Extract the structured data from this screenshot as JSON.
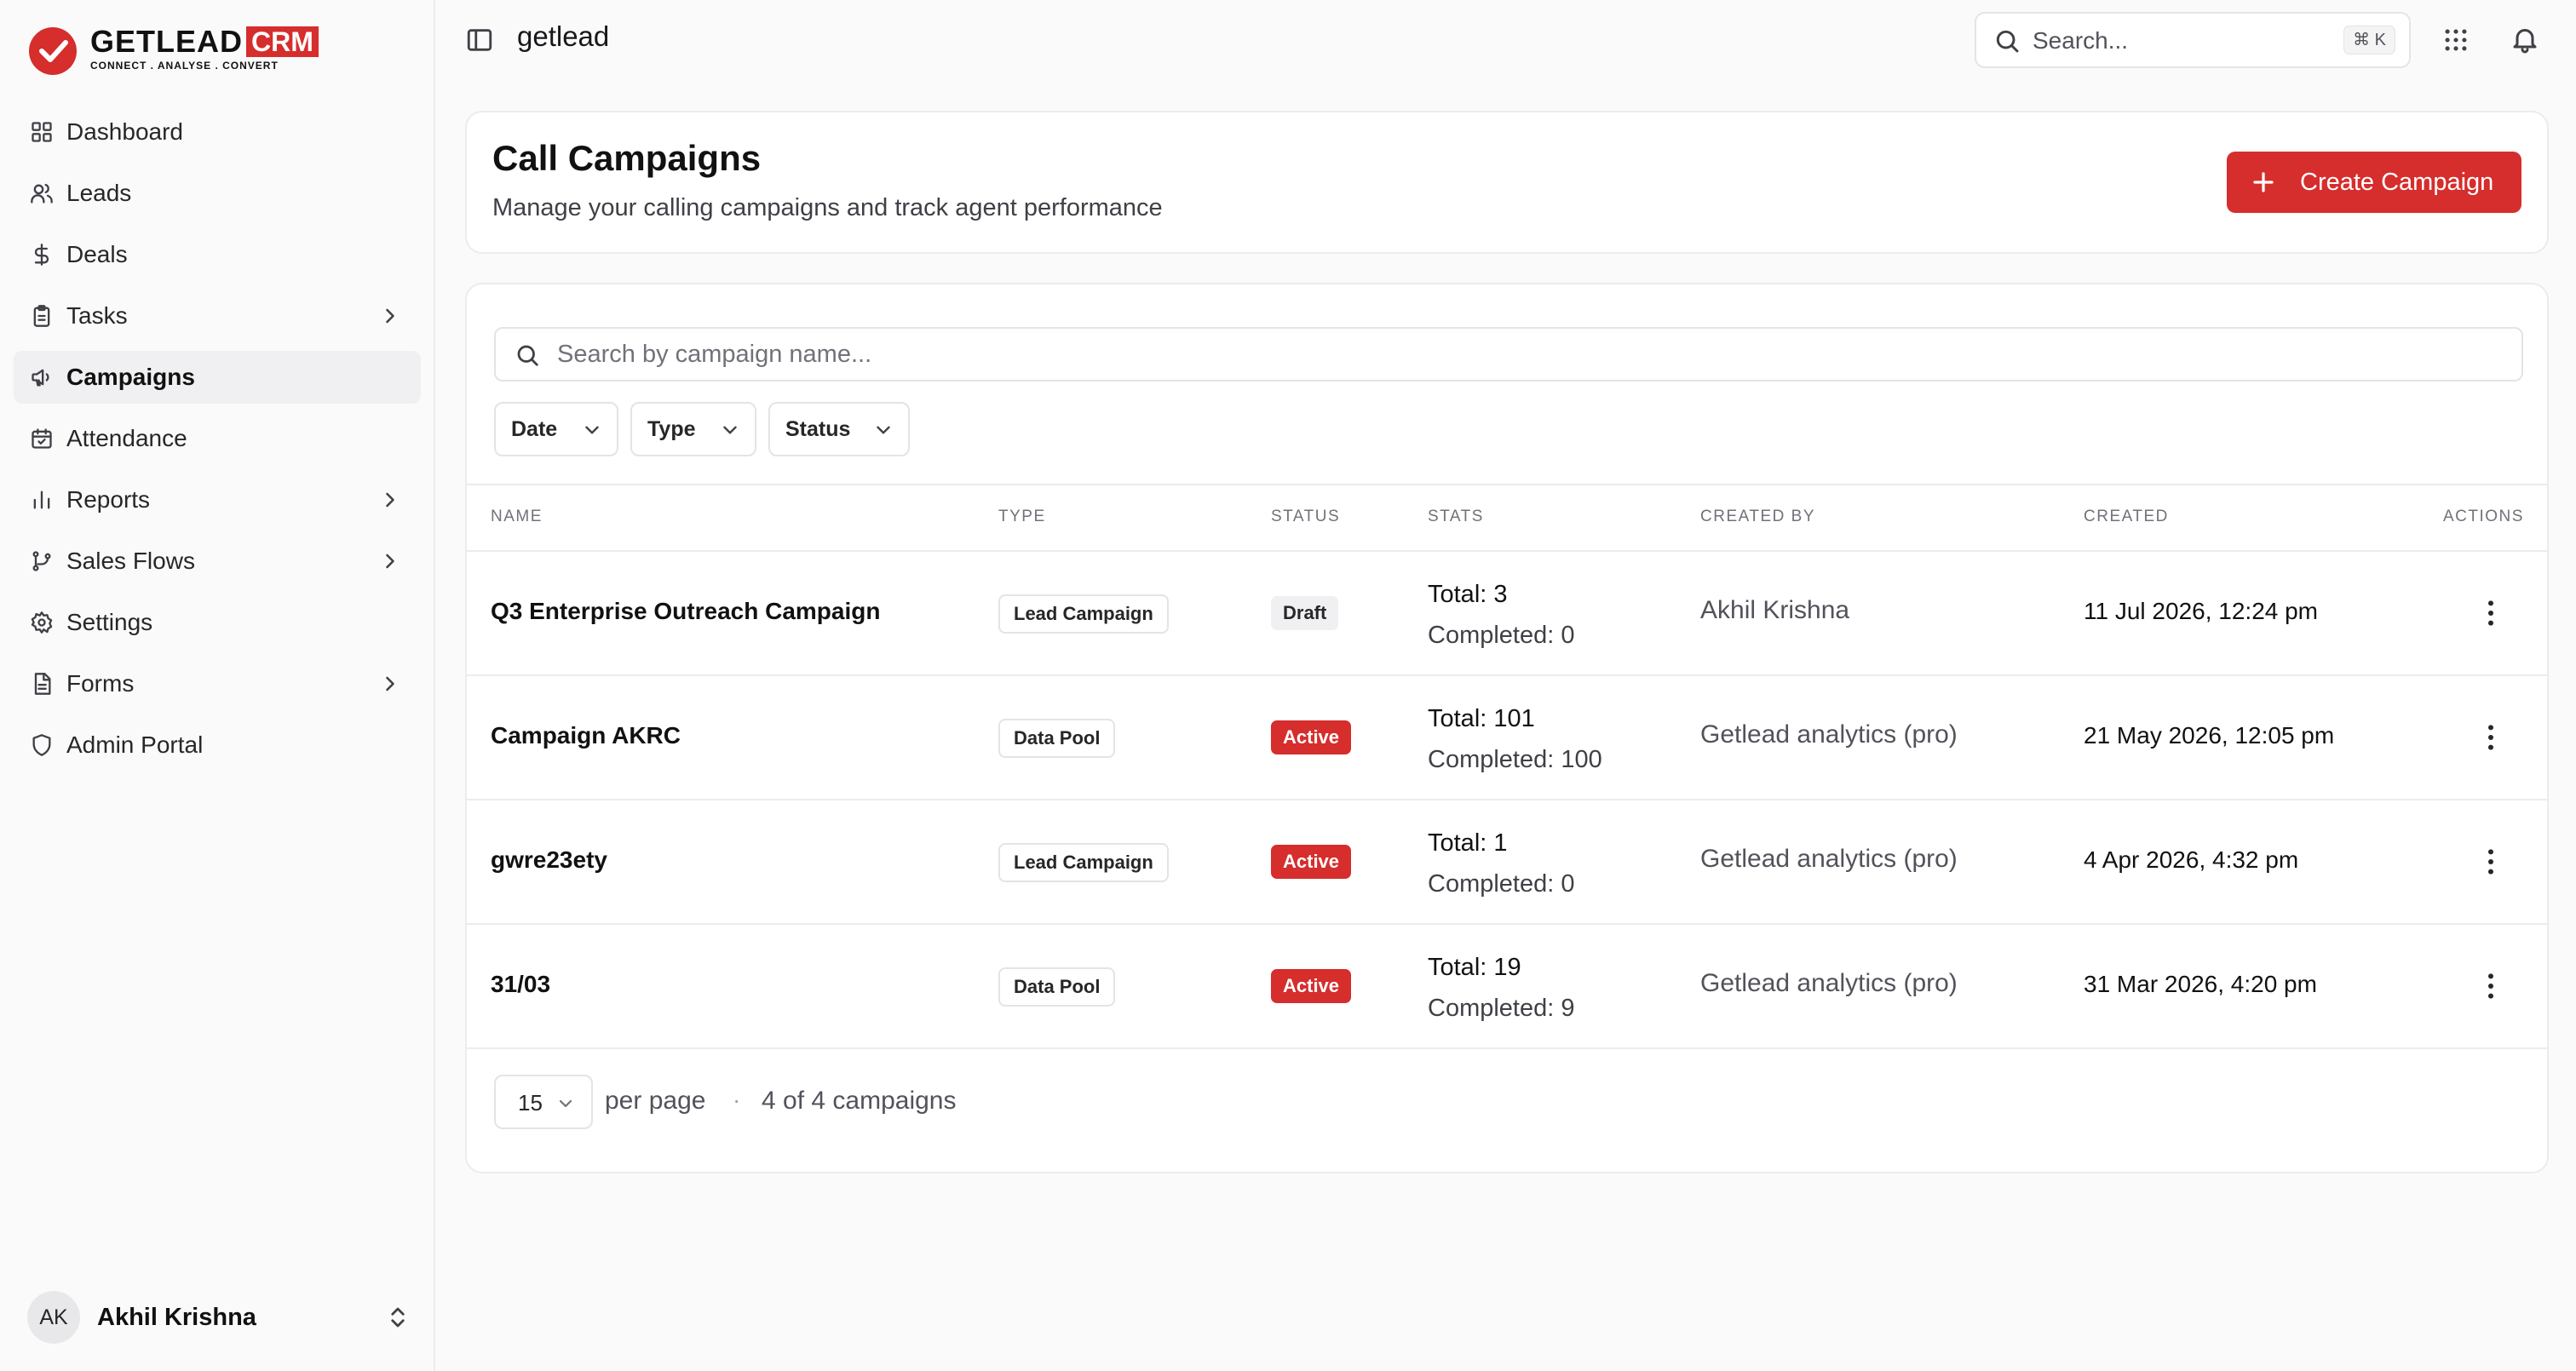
{
  "brand": {
    "name": "GETLEAD",
    "suffix": "CRM",
    "tagline": "CONNECT  .  ANALYSE  .  CONVERT",
    "accent": "#d62d2d"
  },
  "sidebar": {
    "items": [
      {
        "label": "Dashboard",
        "icon": "grid-icon"
      },
      {
        "label": "Leads",
        "icon": "users-icon"
      },
      {
        "label": "Deals",
        "icon": "dollar-icon"
      },
      {
        "label": "Tasks",
        "icon": "clipboard-icon",
        "expandable": true
      },
      {
        "label": "Campaigns",
        "icon": "megaphone-icon",
        "active": true
      },
      {
        "label": "Attendance",
        "icon": "calendar-check-icon"
      },
      {
        "label": "Reports",
        "icon": "bar-chart-icon",
        "expandable": true
      },
      {
        "label": "Sales Flows",
        "icon": "git-branch-icon",
        "expandable": true
      },
      {
        "label": "Settings",
        "icon": "gear-icon"
      },
      {
        "label": "Forms",
        "icon": "form-icon",
        "expandable": true
      },
      {
        "label": "Admin Portal",
        "icon": "shield-icon"
      }
    ],
    "user": {
      "initials": "AK",
      "name": "Akhil Krishna"
    }
  },
  "topbar": {
    "title": "getlead",
    "search_placeholder": "Search...",
    "shortcut": "⌘ K"
  },
  "header": {
    "title": "Call Campaigns",
    "subtitle": "Manage your calling campaigns and track agent performance",
    "create_label": "Create Campaign"
  },
  "filters": {
    "search_placeholder": "Search by campaign name...",
    "date_label": "Date",
    "type_label": "Type",
    "status_label": "Status"
  },
  "table": {
    "columns": [
      "NAME",
      "TYPE",
      "STATUS",
      "STATS",
      "CREATED BY",
      "CREATED",
      "ACTIONS"
    ],
    "rows": [
      {
        "name": "Q3 Enterprise Outreach Campaign",
        "type": "Lead Campaign",
        "status": "Draft",
        "total": "Total: 3",
        "completed": "Completed: 0",
        "created_by": "Akhil Krishna",
        "created": "11 Jul 2026, 12:24 pm"
      },
      {
        "name": "Campaign AKRC",
        "type": "Data Pool",
        "status": "Active",
        "total": "Total: 101",
        "completed": "Completed: 100",
        "created_by": "Getlead analytics (pro)",
        "created": "21 May 2026, 12:05 pm"
      },
      {
        "name": "gwre23ety",
        "type": "Lead Campaign",
        "status": "Active",
        "total": "Total: 1",
        "completed": "Completed: 0",
        "created_by": "Getlead analytics (pro)",
        "created": "4 Apr 2026, 4:32 pm"
      },
      {
        "name": "31/03",
        "type": "Data Pool",
        "status": "Active",
        "total": "Total: 19",
        "completed": "Completed: 9",
        "created_by": "Getlead analytics (pro)",
        "created": "31 Mar 2026, 4:20 pm"
      }
    ]
  },
  "pagination": {
    "per_page": "15",
    "per_page_label": "per page",
    "separator": "·",
    "count_label": "4 of 4 campaigns"
  }
}
